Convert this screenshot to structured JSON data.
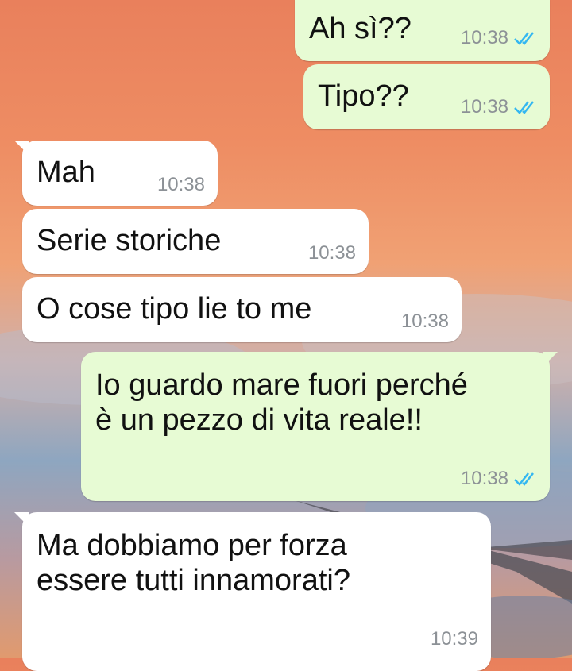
{
  "messages": [
    {
      "direction": "outgoing",
      "text": "Ah sì??",
      "time": "10:38",
      "status": "read"
    },
    {
      "direction": "outgoing",
      "text": "Tipo??",
      "time": "10:38",
      "status": "read"
    },
    {
      "direction": "incoming",
      "text": "Mah",
      "time": "10:38"
    },
    {
      "direction": "incoming",
      "text": "Serie storiche",
      "time": "10:38"
    },
    {
      "direction": "incoming",
      "text": "O cose tipo lie to me",
      "time": "10:38"
    },
    {
      "direction": "outgoing",
      "text": "Io guardo mare fuori perché\nè un pezzo di vita reale!!",
      "time": "10:38",
      "status": "read"
    },
    {
      "direction": "incoming",
      "text": "Ma dobbiamo per forza\nessere tutti innamorati?",
      "time": "10:39"
    }
  ],
  "colors": {
    "outgoing_bubble": "#e7fbd4",
    "incoming_bubble": "#ffffff",
    "read_ticks": "#34b7f1",
    "timestamp": "#8c9196"
  },
  "icons": {
    "read_receipt": "double-check-icon"
  }
}
